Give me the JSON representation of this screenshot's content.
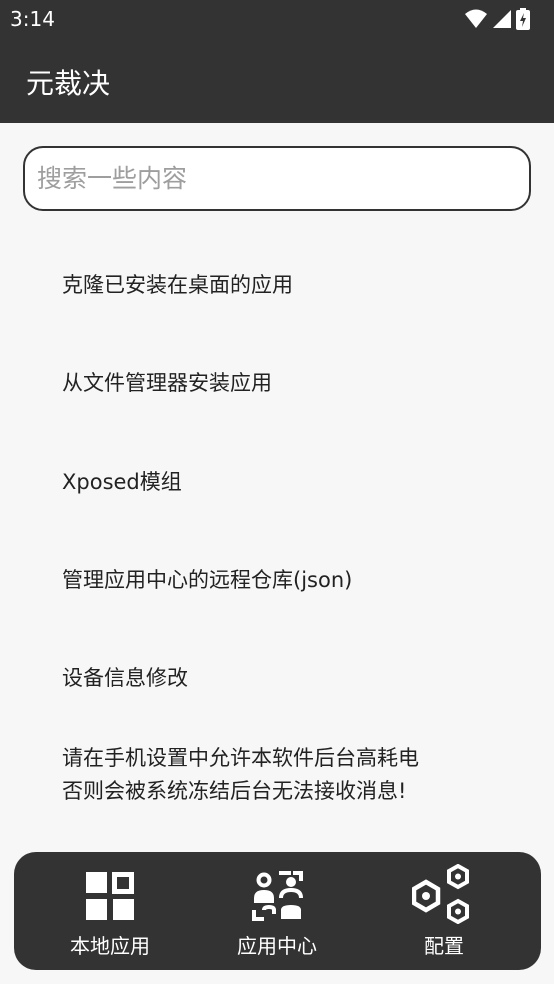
{
  "status_bar": {
    "time": "3:14"
  },
  "app_bar": {
    "title": "元裁决"
  },
  "search": {
    "placeholder": "搜索一些内容",
    "value": ""
  },
  "menu": [
    {
      "label": "克隆已安装在桌面的应用"
    },
    {
      "label": "从文件管理器安装应用"
    },
    {
      "label": "Xposed模组"
    },
    {
      "label": "管理应用中心的远程仓库(json)"
    },
    {
      "label": "设备信息修改"
    }
  ],
  "notice": {
    "line1": "请在手机设置中允许本软件后台高耗电",
    "line2": "否则会被系统冻结后台无法接收消息!"
  },
  "bottom_nav": [
    {
      "label": "本地应用",
      "icon": "grid-icon"
    },
    {
      "label": "应用中心",
      "icon": "app-center-icon"
    },
    {
      "label": "配置",
      "icon": "hexagon-settings-icon"
    }
  ],
  "colors": {
    "bar": "#333333",
    "background": "#f7f7f7",
    "text": "#222222",
    "placeholder": "#9e9e9e"
  }
}
